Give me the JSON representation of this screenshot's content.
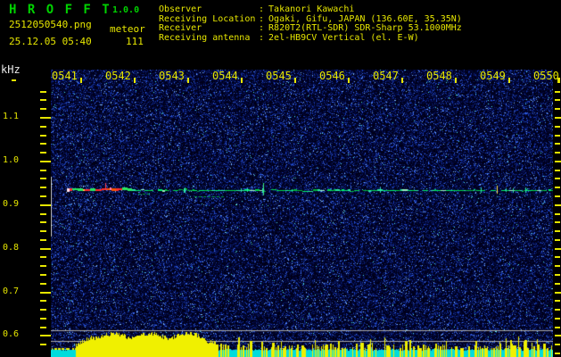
{
  "header": {
    "title": "H R O F F T",
    "version": "1.0.0",
    "filename": "2512050540.png",
    "mode_label": "meteor",
    "datetime": "25.12.05 05:40",
    "echo_count": "111",
    "info": [
      {
        "label": "Observer",
        "value": "Takanori Kawachi"
      },
      {
        "label": "Receiving Location",
        "value": "Ogaki, Gifu, JAPAN (136.60E, 35.35N)"
      },
      {
        "label": "Receiver",
        "value": "R820T2(RTL-SDR) SDR-Sharp 53.1000MHz"
      },
      {
        "label": "Receiving antenna",
        "value": "2el-HB9CV Vertical (el. E-W)"
      }
    ]
  },
  "axis": {
    "y_unit": "kHz",
    "y_major_labels": [
      "1.1",
      "1.0",
      "0.9",
      "0.8",
      "0.7",
      "0.6"
    ],
    "x_labels": [
      "0541",
      "0542",
      "0543",
      "0544",
      "0545",
      "0546",
      "0547",
      "0548",
      "0549",
      "0550"
    ]
  },
  "chart_data": {
    "type": "heatmap",
    "title": "HROFFT 1.0.0 radio meteor observation spectrogram (audio frequency vs time)",
    "x": {
      "tick_labels": [
        "0541",
        "0542",
        "0543",
        "0544",
        "0545",
        "0546",
        "0547",
        "0548",
        "0549",
        "0550"
      ],
      "unit": "time HHMM",
      "start": "25.12.05 05:40",
      "minutes_per_division": 1
    },
    "y": {
      "unit": "kHz",
      "tick_labels": [
        1.1,
        1.0,
        0.9,
        0.8,
        0.7,
        0.6
      ],
      "visible_range": [
        0.57,
        1.19
      ],
      "minor_tick_step_khz": 0.02
    },
    "background": "dark blue random noise field with sparse bright blue/cyan speckles",
    "carrier_line": {
      "khz": 0.935,
      "from": "0541:20",
      "to": "0550:00",
      "appearance": "thin continuous green/cyan trace with small vertical blips"
    },
    "strong_echo_segment": {
      "khz": 0.935,
      "from": "0541:20",
      "to": "0542:30",
      "appearance": "saturated red/pink/white/yellow overload segment"
    },
    "reference_lines_khz": [
      0.61,
      0.59
    ],
    "frequency_window_marker_khz": [
      0.965,
      0.83
    ],
    "echo_count": 111,
    "activity_graph": {
      "burst": {
        "from": "0541:30",
        "to": "0543:10",
        "appearance": "solid yellow saturated level burst"
      },
      "baseline": "flat cyan strip along bottom with dense 1-3px yellow spike bars for the rest of the period"
    }
  },
  "colors": {
    "background": "#000000",
    "text_yellow": "#e6e600",
    "title_green": "#00d200",
    "text_white": "#ececec",
    "noise_base": "#00001a",
    "carrier_green": "#00d84a",
    "carrier_cyan": "#2ae9a0",
    "echo_red": "#ff2e2e",
    "echo_pink": "#ff7eb5",
    "echo_white": "#ffffff",
    "echo_yellow": "#ffd24a",
    "activity_cyan": "#00dcdc",
    "activity_yellow": "#f0f000",
    "reference_gray": "#a9a9a9",
    "marker_gray": "#bbbbbb"
  }
}
